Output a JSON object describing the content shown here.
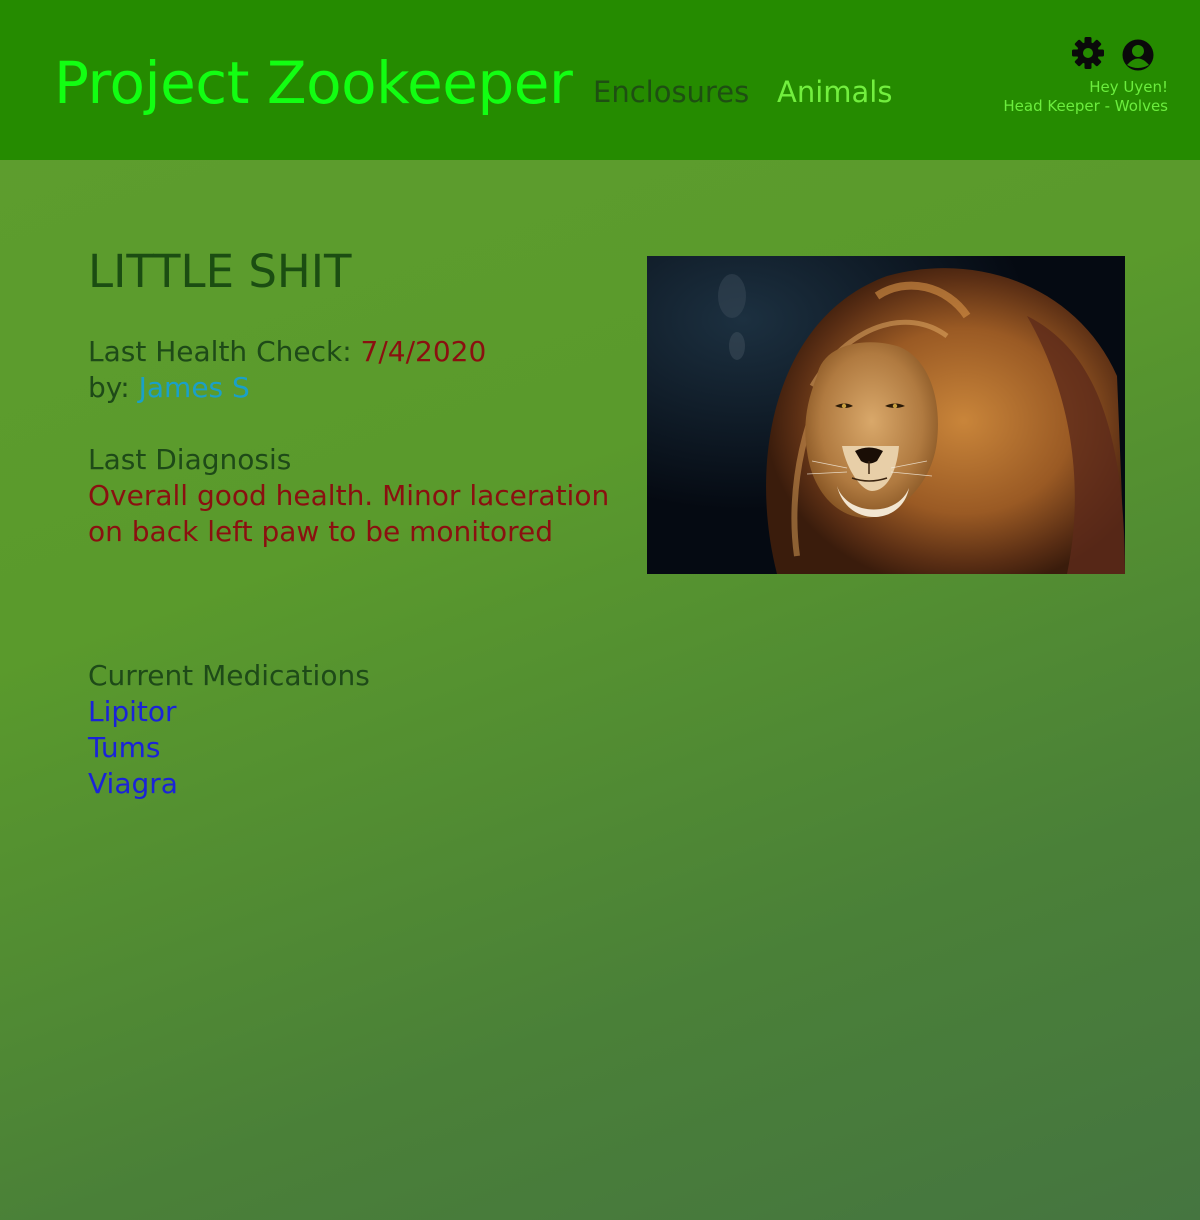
{
  "header": {
    "app_title": "Project Zookeeper",
    "nav": [
      {
        "label": "Enclosures"
      },
      {
        "label": "Animals"
      }
    ],
    "user": {
      "greeting": "Hey Uyen!",
      "role": "Head Keeper - Wolves"
    }
  },
  "animal": {
    "name": "LITTLE SHIT",
    "health_check": {
      "label": "Last Health Check: ",
      "date": "7/4/2020",
      "by_label": "by: ",
      "by": "James S"
    },
    "diagnosis": {
      "label": "Last Diagnosis",
      "line1": "Overall good health. Minor laceration",
      "line2": "on back left paw to be monitored"
    },
    "medications": {
      "label": "Current Medications",
      "items": [
        "Lipitor",
        "Tums",
        "Viagra"
      ]
    },
    "photo_subject": "lion-photo"
  },
  "colors": {
    "header_bg": "#258b00",
    "title": "#12ff12",
    "date": "#8a1010",
    "vet_link": "#1aa0c8",
    "med_link": "#1a23d8"
  }
}
